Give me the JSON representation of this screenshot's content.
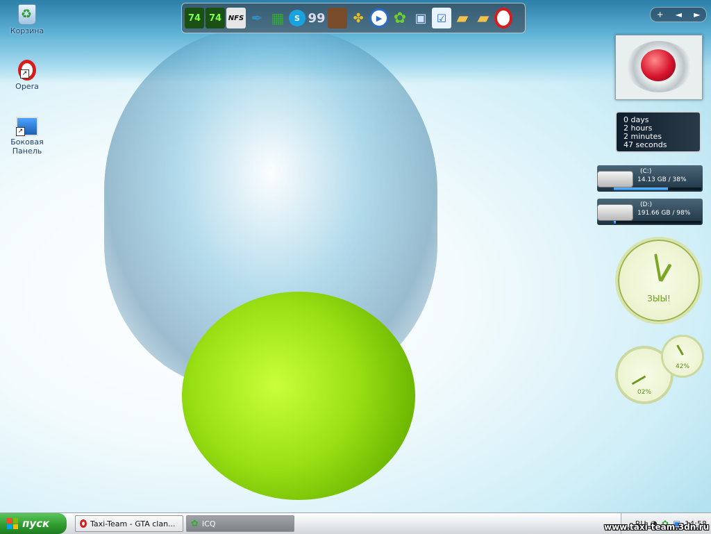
{
  "desktop": {
    "icons": [
      {
        "label": "Корзина"
      },
      {
        "label": "Opera"
      },
      {
        "label": "Боковая Панель"
      }
    ]
  },
  "dock": {
    "items": [
      {
        "icon": "gta-vice-city-icon",
        "text": "74"
      },
      {
        "icon": "gta-san-andreas-icon",
        "text": "74"
      },
      {
        "icon": "nfs-icon",
        "text": "NFS"
      },
      {
        "icon": "feather-icon",
        "text": ""
      },
      {
        "icon": "green-app-icon",
        "text": ""
      },
      {
        "icon": "skype-icon",
        "text": "S"
      },
      {
        "icon": "laptop-icon",
        "text": "99"
      },
      {
        "icon": "face-game-icon",
        "text": ""
      },
      {
        "icon": "puzzle-icon",
        "text": ""
      },
      {
        "icon": "media-player-icon",
        "text": "▶"
      },
      {
        "icon": "icq-flower-icon",
        "text": "✿"
      },
      {
        "icon": "my-computer-icon",
        "text": ""
      },
      {
        "icon": "checkbox-icon",
        "text": "☑"
      },
      {
        "icon": "folder-icon",
        "text": ""
      },
      {
        "icon": "folder-open-icon",
        "text": ""
      },
      {
        "icon": "opera-icon",
        "text": ""
      }
    ]
  },
  "gadget_control": {
    "add": "+",
    "prev": "◄",
    "next": "►"
  },
  "uptime": {
    "days": "0 days",
    "hours": "2 hours",
    "minutes": "2 minutes",
    "seconds": "47 seconds"
  },
  "drives": [
    {
      "name": "(C:)",
      "info": "14.13 GB / 38%",
      "usage": 0.62
    },
    {
      "name": "(D:)",
      "info": "191.66 GB / 98%",
      "usage": 0.02
    }
  ],
  "clock": {
    "text": "ЗЫЫ!"
  },
  "gauges": {
    "cpu_value": "02%",
    "mem_value": "42%",
    "scale": [
      "20",
      "30",
      "40",
      "50",
      "70",
      "100"
    ]
  },
  "taskbar": {
    "start_label": "пуск",
    "tasks": [
      {
        "label": "Taxi-Team - GTA clan..."
      },
      {
        "label": "ICQ"
      }
    ],
    "tray": {
      "lang": "RU",
      "time": "14:58"
    }
  },
  "watermark": "www.taxi-team.3dn.ru"
}
